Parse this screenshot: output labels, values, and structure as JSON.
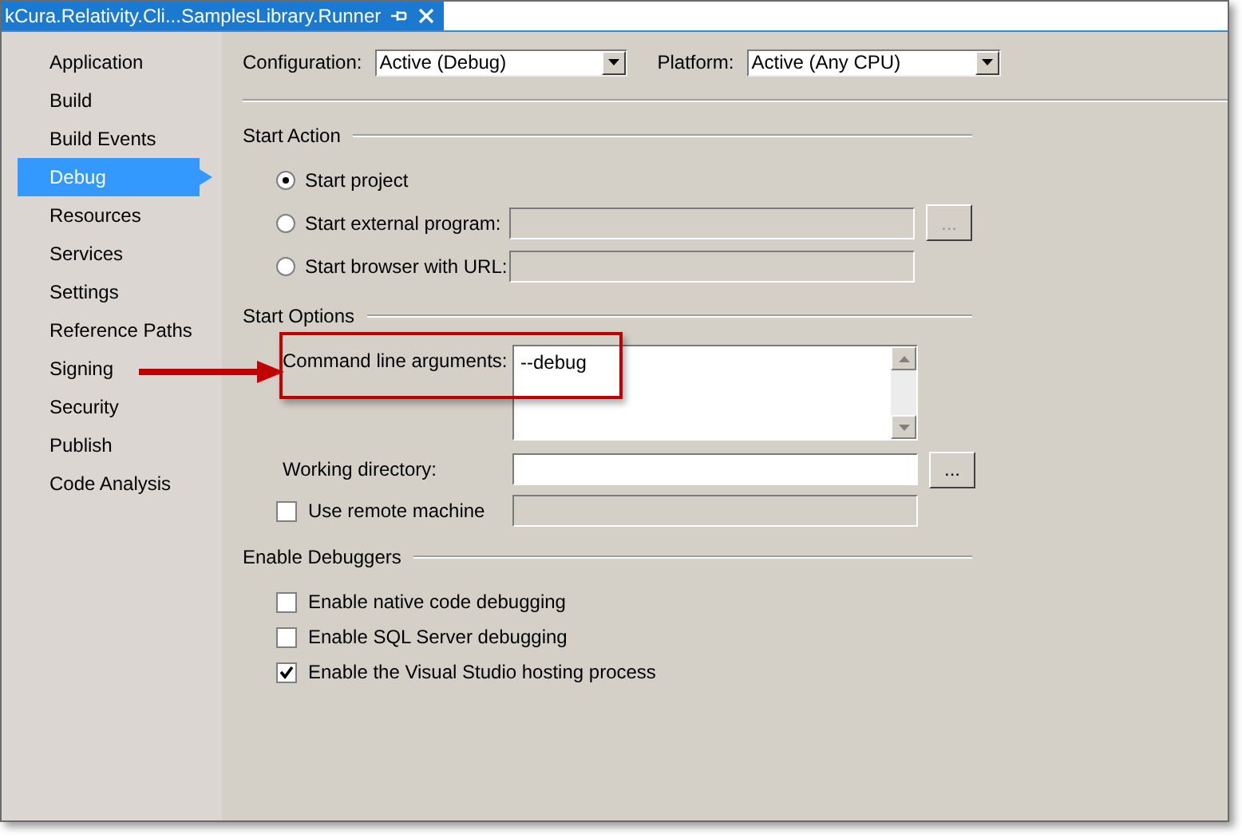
{
  "tab": {
    "title": "kCura.Relativity.Cli...SamplesLibrary.Runner"
  },
  "sidebar": {
    "items": [
      {
        "label": "Application",
        "selected": false
      },
      {
        "label": "Build",
        "selected": false
      },
      {
        "label": "Build Events",
        "selected": false
      },
      {
        "label": "Debug",
        "selected": true
      },
      {
        "label": "Resources",
        "selected": false
      },
      {
        "label": "Services",
        "selected": false
      },
      {
        "label": "Settings",
        "selected": false
      },
      {
        "label": "Reference Paths",
        "selected": false
      },
      {
        "label": "Signing",
        "selected": false
      },
      {
        "label": "Security",
        "selected": false
      },
      {
        "label": "Publish",
        "selected": false
      },
      {
        "label": "Code Analysis",
        "selected": false
      }
    ]
  },
  "configuration": {
    "label": "Configuration:",
    "value": "Active (Debug)"
  },
  "platform": {
    "label": "Platform:",
    "value": "Active (Any CPU)"
  },
  "start_action": {
    "heading": "Start Action",
    "options": [
      {
        "label": "Start project",
        "selected": true
      },
      {
        "label": "Start external program:",
        "selected": false,
        "field": {
          "disabled": true
        },
        "browse_button": {
          "label": "...",
          "disabled": true
        }
      },
      {
        "label": "Start browser with URL:",
        "selected": false,
        "field": {
          "disabled": true
        }
      }
    ]
  },
  "start_options": {
    "heading": "Start Options",
    "command_line": {
      "label": "Command line arguments:",
      "value": "--debug"
    },
    "working_directory": {
      "label": "Working directory:",
      "browse_button": {
        "label": "...",
        "disabled": false
      }
    },
    "remote_machine": {
      "label": "Use remote machine",
      "checked": false,
      "field": {
        "disabled": true
      }
    }
  },
  "debuggers": {
    "heading": "Enable Debuggers",
    "options": [
      {
        "label": "Enable native code debugging",
        "checked": false
      },
      {
        "label": "Enable SQL Server debugging",
        "checked": false
      },
      {
        "label": "Enable the Visual Studio hosting process",
        "checked": true
      }
    ]
  }
}
